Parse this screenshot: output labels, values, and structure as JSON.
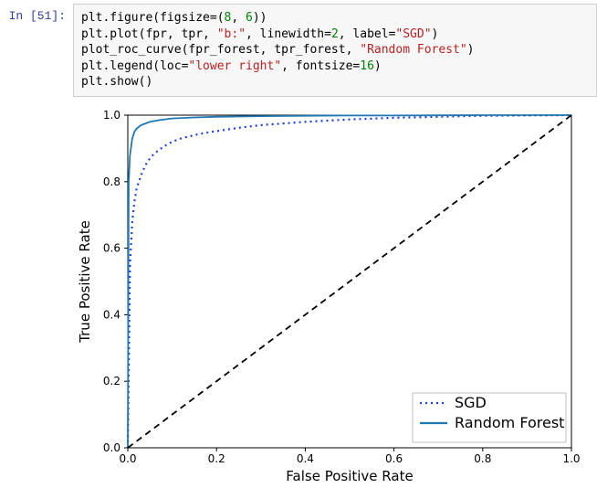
{
  "cell": {
    "prompt_prefix": "In ",
    "prompt_num": "[51]:",
    "code_lines": [
      [
        {
          "t": "plt.figure(figsize=("
        },
        {
          "t": "8",
          "cls": "c-num"
        },
        {
          "t": ", "
        },
        {
          "t": "6",
          "cls": "c-num"
        },
        {
          "t": "))"
        }
      ],
      [
        {
          "t": "plt.plot(fpr, tpr, "
        },
        {
          "t": "\"b:\"",
          "cls": "c-str"
        },
        {
          "t": ", linewidth="
        },
        {
          "t": "2",
          "cls": "c-num"
        },
        {
          "t": ", label="
        },
        {
          "t": "\"SGD\"",
          "cls": "c-str"
        },
        {
          "t": ")"
        }
      ],
      [
        {
          "t": "plot_roc_curve(fpr_forest, tpr_forest, "
        },
        {
          "t": "\"Random Forest\"",
          "cls": "c-str"
        },
        {
          "t": ")"
        }
      ],
      [
        {
          "t": "plt.legend(loc="
        },
        {
          "t": "\"lower right\"",
          "cls": "c-str"
        },
        {
          "t": ", fontsize="
        },
        {
          "t": "16",
          "cls": "c-num"
        },
        {
          "t": ")"
        }
      ],
      [
        {
          "t": "plt.show()"
        }
      ]
    ]
  },
  "chart_data": {
    "type": "line",
    "title": "",
    "xlabel": "False Positive Rate",
    "ylabel": "True Positive Rate",
    "xlim": [
      0.0,
      1.0
    ],
    "ylim": [
      0.0,
      1.0
    ],
    "xticks": [
      0.0,
      0.2,
      0.4,
      0.6,
      0.8,
      1.0
    ],
    "yticks": [
      0.0,
      0.2,
      0.4,
      0.6,
      0.8,
      1.0
    ],
    "legend_loc": "lower right",
    "series": [
      {
        "name": "SGD",
        "style": "dotted",
        "color": "#1f3fd8",
        "x": [
          0.0,
          0.005,
          0.01,
          0.015,
          0.02,
          0.03,
          0.04,
          0.05,
          0.06,
          0.08,
          0.1,
          0.12,
          0.15,
          0.18,
          0.2,
          0.25,
          0.3,
          0.35,
          0.4,
          0.5,
          0.6,
          0.7,
          0.8,
          0.9,
          1.0
        ],
        "y": [
          0.0,
          0.55,
          0.68,
          0.74,
          0.78,
          0.82,
          0.85,
          0.87,
          0.885,
          0.905,
          0.92,
          0.93,
          0.94,
          0.948,
          0.952,
          0.962,
          0.97,
          0.975,
          0.98,
          0.987,
          0.992,
          0.995,
          0.998,
          0.999,
          1.0
        ]
      },
      {
        "name": "Random Forest",
        "style": "solid",
        "color": "#1f77b4",
        "x": [
          0.0,
          0.002,
          0.005,
          0.008,
          0.01,
          0.015,
          0.02,
          0.03,
          0.04,
          0.05,
          0.07,
          0.1,
          0.15,
          0.2,
          0.3,
          0.4,
          0.5,
          0.6,
          0.8,
          1.0
        ],
        "y": [
          0.0,
          0.8,
          0.88,
          0.91,
          0.93,
          0.95,
          0.96,
          0.97,
          0.975,
          0.98,
          0.985,
          0.99,
          0.993,
          0.995,
          0.997,
          0.998,
          0.999,
          0.999,
          1.0,
          1.0
        ]
      },
      {
        "name": "_diagonal",
        "style": "dashed",
        "color": "#000000",
        "x": [
          0.0,
          1.0
        ],
        "y": [
          0.0,
          1.0
        ],
        "hide_legend": true
      }
    ]
  }
}
